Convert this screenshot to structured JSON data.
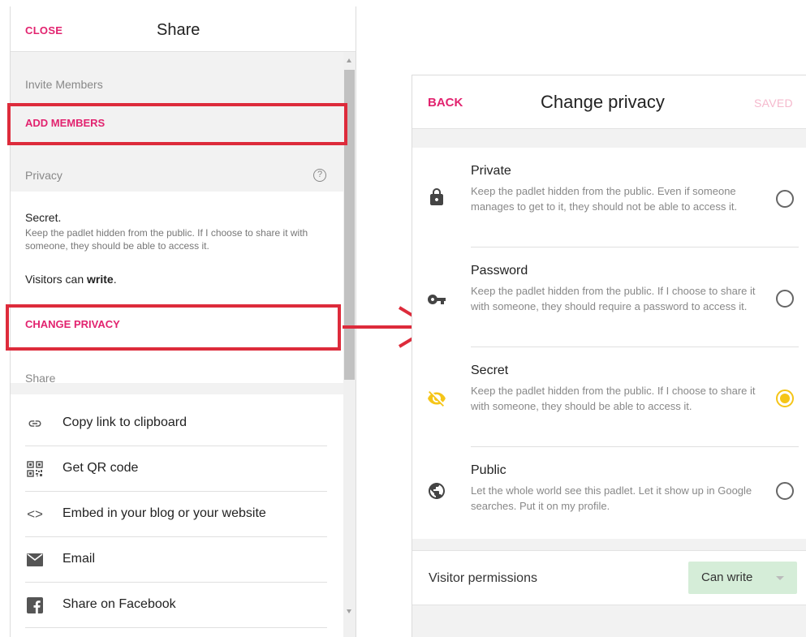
{
  "share_panel": {
    "close_label": "CLOSE",
    "title": "Share",
    "invite_label": "Invite Members",
    "add_members_label": "ADD MEMBERS",
    "privacy_label": "Privacy",
    "current_privacy": {
      "name": "Secret.",
      "description": "Keep the padlet hidden from the public. If I choose to share it with someone, they should be able to access it.",
      "visitors_prefix": "Visitors can ",
      "visitors_permission": "write",
      "visitors_suffix": "."
    },
    "change_privacy_label": "CHANGE PRIVACY",
    "share_label": "Share",
    "items": [
      {
        "label": "Copy link to clipboard",
        "icon": "link-icon"
      },
      {
        "label": "Get QR code",
        "icon": "qr-code-icon"
      },
      {
        "label": "Embed in your blog or your website",
        "icon": "code-icon"
      },
      {
        "label": "Email",
        "icon": "email-icon"
      },
      {
        "label": "Share on Facebook",
        "icon": "facebook-icon"
      }
    ]
  },
  "privacy_panel": {
    "back_label": "BACK",
    "title": "Change privacy",
    "saved_label": "SAVED",
    "options": [
      {
        "title": "Private",
        "description": "Keep the padlet hidden from the public. Even if someone manages to get to it, they should not be able to access it.",
        "icon": "lock-icon",
        "selected": false
      },
      {
        "title": "Password",
        "description": "Keep the padlet hidden from the public. If I choose to share it with someone, they should require a password to access it.",
        "icon": "key-icon",
        "selected": false
      },
      {
        "title": "Secret",
        "description": "Keep the padlet hidden from the public. If I choose to share it with someone, they should be able to access it.",
        "icon": "eye-off-icon",
        "selected": true
      },
      {
        "title": "Public",
        "description": "Let the whole world see this padlet. Let it show up in Google searches. Put it on my profile.",
        "icon": "globe-icon",
        "selected": false
      }
    ],
    "visitor_permissions_label": "Visitor permissions",
    "visitor_permissions_value": "Can write"
  },
  "colors": {
    "accent_pink": "#e2236f",
    "highlight_red": "#dd2b3b",
    "selected_yellow": "#f5c518",
    "permission_green": "#d5edd8"
  }
}
